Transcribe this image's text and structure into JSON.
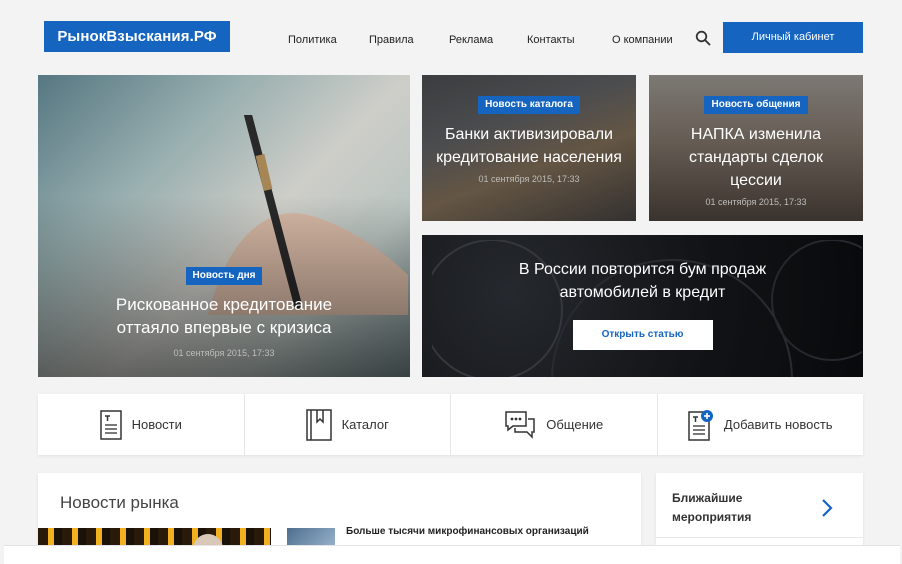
{
  "header": {
    "logo": "РынокВзыскания.РФ",
    "nav": [
      "Политика",
      "Правила",
      "Реклама",
      "Контакты",
      "О компании"
    ],
    "cabinet_label": "Личный кабинет"
  },
  "hero": {
    "badge": "Новость дня",
    "title": "Рискованное кредитование оттаяло впервые с кризиса",
    "date": "01 сентября 2015, 17:33"
  },
  "card_catalog": {
    "badge": "Новость каталога",
    "title": "Банки активизировали кредитование населения",
    "date": "01 сентября 2015, 17:33"
  },
  "card_talk": {
    "badge": "Новость общения",
    "title": "НАПКА изменила стандарты сделок цессии",
    "date": "01 сентября 2015, 17:33"
  },
  "banner": {
    "title": "В России повторится бум продаж автомобилей в кредит",
    "button": "Открыть статью"
  },
  "categories": [
    {
      "label": "Новости",
      "icon": "document-icon"
    },
    {
      "label": "Каталог",
      "icon": "book-icon"
    },
    {
      "label": "Общение",
      "icon": "chat-icon"
    },
    {
      "label": "Добавить новость",
      "icon": "add-document-icon"
    }
  ],
  "news": {
    "title": "Новости рынка",
    "item_text": "Больше тысячи микрофинансовых организаций"
  },
  "events": {
    "title": "Ближайшие мероприятия"
  },
  "colors": {
    "accent": "#1565c0",
    "background": "#f3f3f3"
  }
}
